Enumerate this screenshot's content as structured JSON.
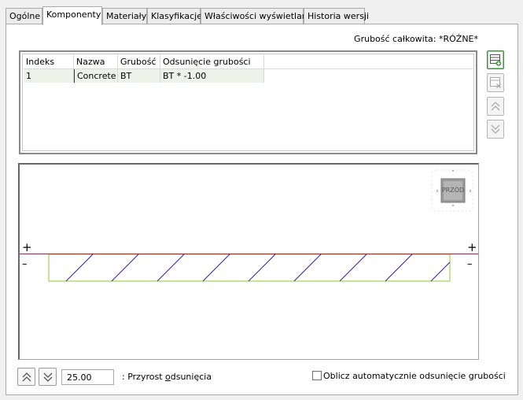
{
  "tabs": [
    {
      "label": "Ogólne"
    },
    {
      "label": "Komponenty"
    },
    {
      "label": "Materiały"
    },
    {
      "label": "Klasyfikacje"
    },
    {
      "label": "Właściwości wyświetlania"
    },
    {
      "label": "Historia wersji"
    }
  ],
  "active_tab": "Komponenty",
  "total_thickness": "Grubość całkowita: *RÓŻNE*",
  "grid": {
    "columns": [
      "Indeks",
      "Nazwa",
      "Grubość",
      "Odsunięcie grubości"
    ],
    "rows": [
      [
        "1",
        "Concrete",
        "BT",
        "BT * -1.00"
      ]
    ]
  },
  "side_buttons": [
    "add-component-icon",
    "delete-component-icon",
    "move-up-icon",
    "move-down-icon"
  ],
  "preview": {
    "view_label": "PRZÓD",
    "plus": "+",
    "minus": "–",
    "line_color_top": "#c0184a",
    "layer_border_color": "#8ccc2a",
    "hatch_color": "#3a1a9a"
  },
  "bottom": {
    "offset_value": "25.00",
    "offset_label_prefix": ": Przyrost ",
    "offset_label_underlined": "o",
    "offset_label_rest": "dsunięcia",
    "auto_label_text": "Oblicz automatycznie odsunięcie grubości",
    "auto_checked": false
  }
}
